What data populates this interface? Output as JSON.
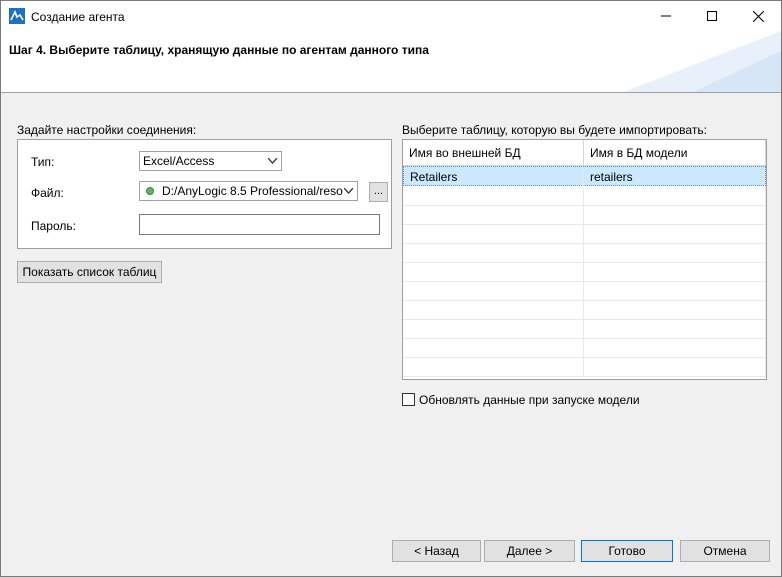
{
  "window": {
    "title": "Создание агента"
  },
  "header": {
    "title": "Шаг 4. Выберите таблицу, хранящую данные по агентам данного типа"
  },
  "connection": {
    "section_label": "Задайте настройки соединения:",
    "type_label": "Тип:",
    "type_value": "Excel/Access",
    "file_label": "Файл:",
    "file_value": "D:/AnyLogic 8.5 Professional/reso",
    "browse_label": "...",
    "password_label": "Пароль:",
    "password_value": ""
  },
  "show_tables_button": "Показать список таблиц",
  "table_select": {
    "section_label": "Выберите таблицу, которую вы будете импортировать:",
    "columns": [
      "Имя во внешней БД",
      "Имя в БД модели"
    ],
    "rows": [
      [
        "Retailers",
        "retailers"
      ]
    ],
    "selected_row": 0
  },
  "refresh_checkbox": {
    "label": "Обновлять данные при запуске модели",
    "checked": false
  },
  "footer": {
    "back": "< Назад",
    "next": "Далее >",
    "finish": "Готово",
    "cancel": "Отмена"
  }
}
